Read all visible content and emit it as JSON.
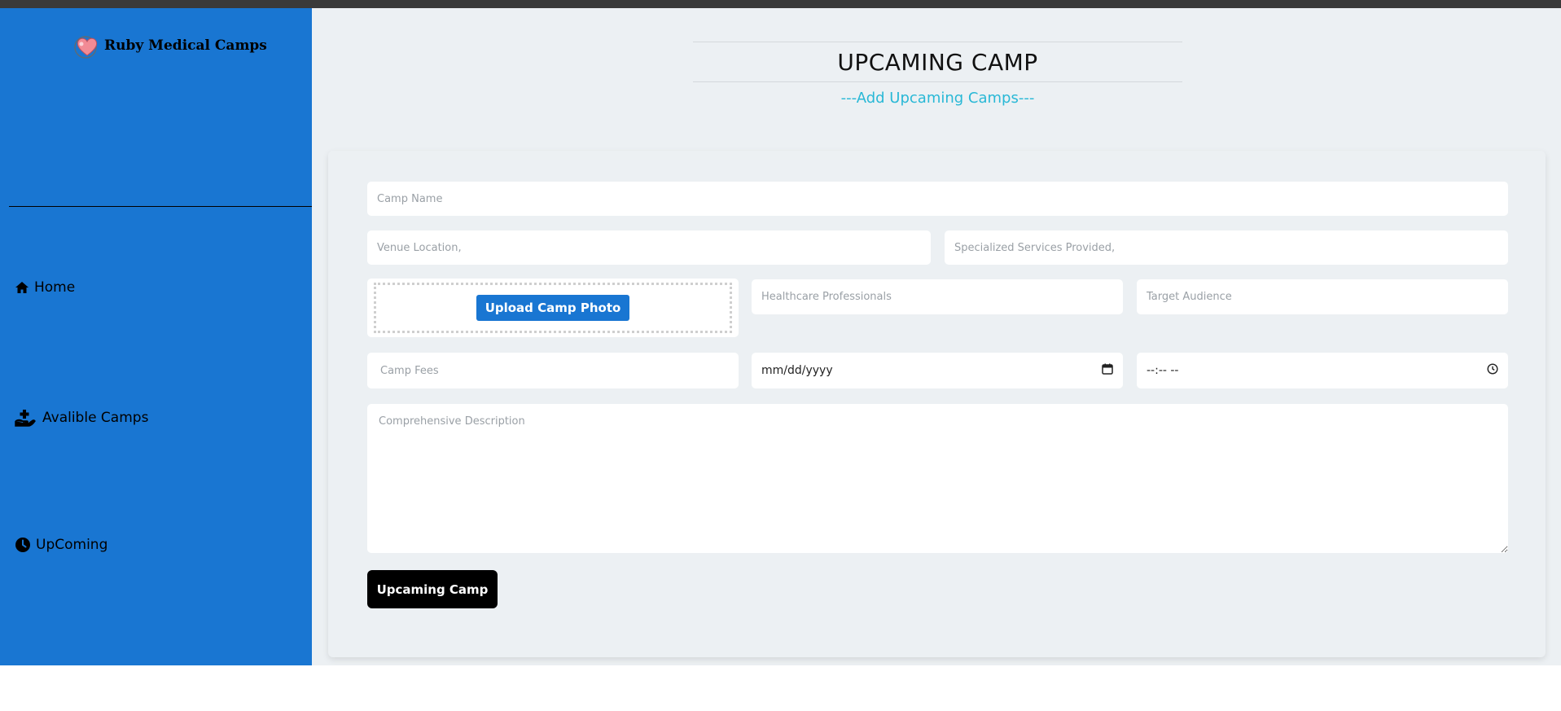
{
  "sidebar": {
    "brand": "Ruby Medical Camps",
    "nav": [
      {
        "label": "Home",
        "icon": "home-icon"
      },
      {
        "label": "Avalible Camps",
        "icon": "hand-plus-icon"
      },
      {
        "label": "UpComing",
        "icon": "clock-icon"
      }
    ]
  },
  "header": {
    "title": "UPCAMING CAMP",
    "subtitle": "---Add Upcaming Camps---"
  },
  "form": {
    "camp_name_placeholder": "Camp Name",
    "venue_placeholder": "Venue Location,",
    "services_placeholder": "Specialized Services Provided,",
    "upload_label": "Upload Camp Photo",
    "professionals_placeholder": "Healthcare Professionals",
    "audience_placeholder": "Target Audience",
    "fees_placeholder": "Camp Fees",
    "date_placeholder": "mm/dd/yyyy",
    "time_placeholder": "--:-- --",
    "description_placeholder": "Comprehensive Description",
    "submit_label": "Upcaming Camp"
  },
  "colors": {
    "sidebar": "#1976d2",
    "background": "#ecf0f3",
    "subtitle": "#29b8d6",
    "upload_button": "#1976d2",
    "submit_button": "#000000"
  }
}
